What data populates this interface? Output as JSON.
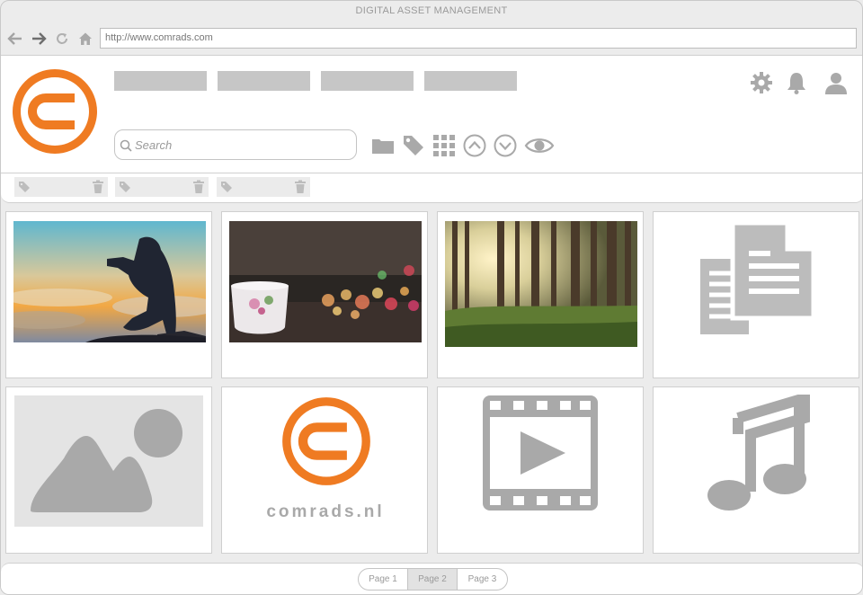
{
  "window": {
    "title": "DIGITAL ASSET MANAGEMENT"
  },
  "browser": {
    "url": "http://www.comrads.com",
    "nav": [
      "back-arrow-icon",
      "forward-arrow-icon",
      "reload-icon",
      "home-icon"
    ]
  },
  "header": {
    "brand_color": "#ef7b22",
    "menu_placeholders": 4,
    "icons": [
      "gear-icon",
      "bell-icon",
      "user-icon"
    ]
  },
  "search": {
    "placeholder": "Search"
  },
  "toolbar": {
    "icons": [
      "folder-icon",
      "tag-icon",
      "grid-view-icon",
      "sort-ascending-icon",
      "sort-descending-icon",
      "eye-icon"
    ]
  },
  "tag_filters": [
    {
      "icon": "tag-icon",
      "remove_icon": "trash-icon"
    },
    {
      "icon": "tag-icon",
      "remove_icon": "trash-icon"
    },
    {
      "icon": "tag-icon",
      "remove_icon": "trash-icon"
    }
  ],
  "assets": [
    {
      "type": "photo",
      "subject": "silhouette-photographer-sunset"
    },
    {
      "type": "photo",
      "subject": "teacup-bokeh"
    },
    {
      "type": "photo",
      "subject": "forest-sunbeams"
    },
    {
      "type": "document",
      "icon": "documents-icon"
    },
    {
      "type": "image",
      "icon": "image-placeholder-icon"
    },
    {
      "type": "logo",
      "wordmark": "comrads.nl"
    },
    {
      "type": "video",
      "icon": "video-film-icon"
    },
    {
      "type": "audio",
      "icon": "music-note-icon"
    }
  ],
  "pagination": {
    "pages": [
      "Page 1",
      "Page 2",
      "Page 3"
    ],
    "active": "Page 2"
  },
  "colors": {
    "icon_gray": "#a9a9a9",
    "placeholder_gray": "#c6c6c6",
    "accent": "#ef7b22"
  }
}
